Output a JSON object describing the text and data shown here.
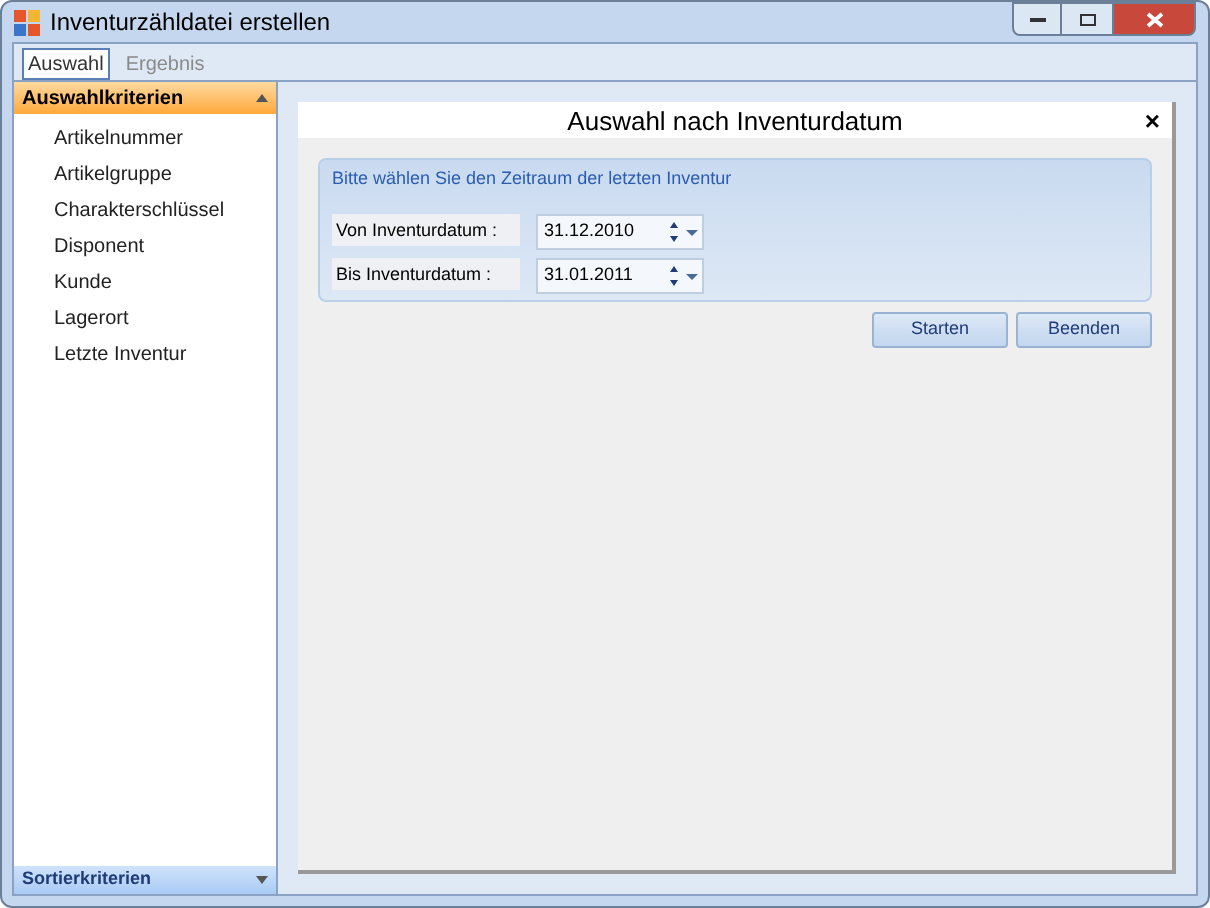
{
  "window": {
    "title": "Inventurzähldatei erstellen"
  },
  "tabs": [
    {
      "label": "Auswahl",
      "selected": true
    },
    {
      "label": "Ergebnis",
      "selected": false
    }
  ],
  "sidebar": {
    "header": "Auswahlkriterien",
    "items": [
      {
        "label": "Artikelnummer"
      },
      {
        "label": "Artikelgruppe"
      },
      {
        "label": "Charakterschlüssel"
      },
      {
        "label": "Disponent"
      },
      {
        "label": "Kunde"
      },
      {
        "label": "Lagerort"
      },
      {
        "label": "Letzte Inventur"
      }
    ],
    "footer": "Sortierkriterien"
  },
  "panel": {
    "title": "Auswahl nach Inventurdatum",
    "close": "×",
    "group": {
      "caption": "Bitte wählen Sie den Zeitraum der letzten Inventur",
      "fields": [
        {
          "label": "Von Inventurdatum :",
          "value": "31.12.2010"
        },
        {
          "label": "Bis Inventurdatum :",
          "value": "31.01.2011"
        }
      ]
    },
    "buttons": [
      "Starten",
      "Beenden"
    ]
  }
}
